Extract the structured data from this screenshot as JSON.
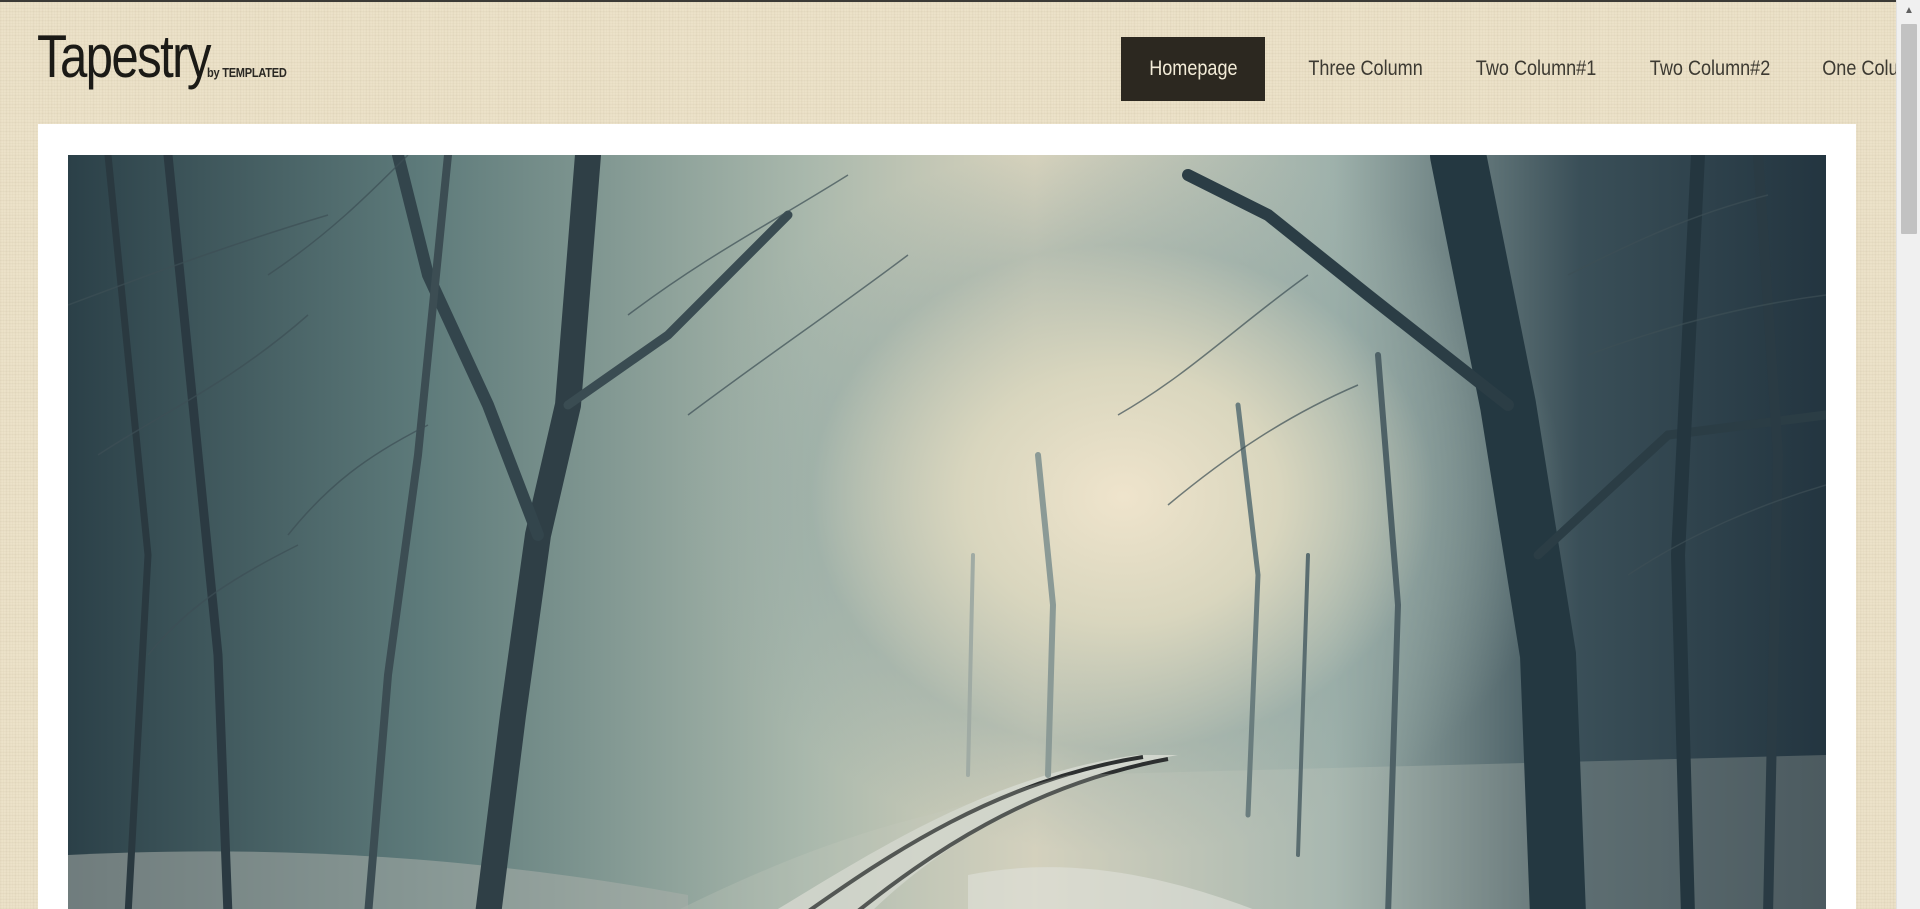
{
  "site": {
    "title": "Tapestry",
    "byline": "by TEMPLATED"
  },
  "nav": {
    "items": [
      {
        "label": "Homepage",
        "active": true
      },
      {
        "label": "Three Column",
        "active": false
      },
      {
        "label": "Two Column#1",
        "active": false
      },
      {
        "label": "Two Column#2",
        "active": false
      },
      {
        "label": "One Column",
        "active": false
      }
    ]
  },
  "hero": {
    "image_subject": "foggy forest railway track"
  },
  "colors": {
    "background": "#ece2c9",
    "nav_active_bg": "#2c2820",
    "nav_active_text": "#f3ecd8",
    "text": "#3d3a32"
  },
  "scrollbar": {
    "up_icon": "chevron-up-icon"
  }
}
